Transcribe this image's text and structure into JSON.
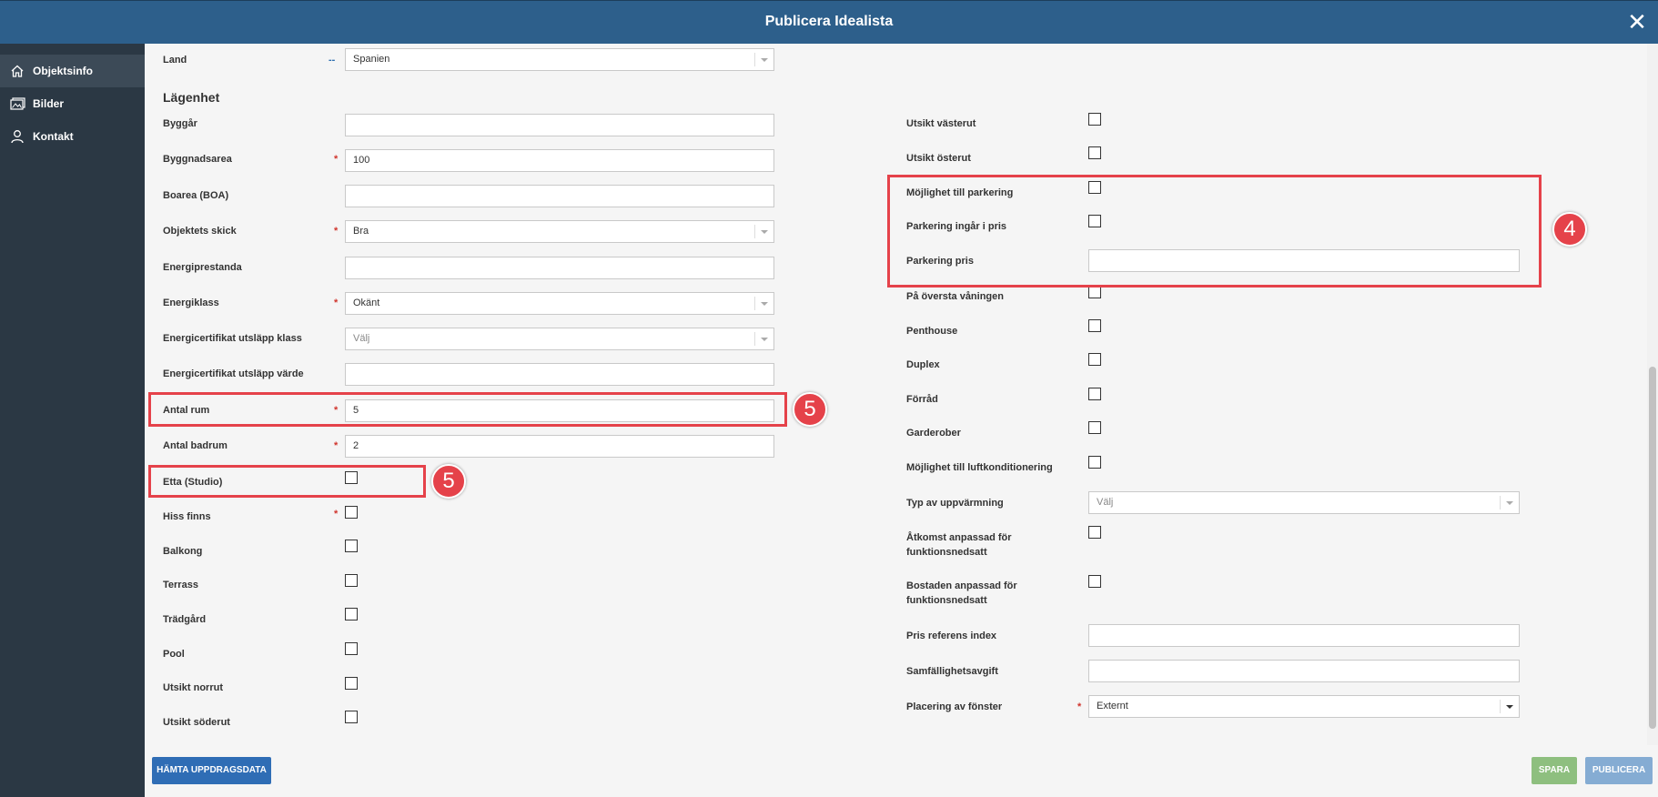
{
  "window": {
    "title": "Publicera Idealista"
  },
  "sidebar": {
    "items": [
      {
        "label": "Objektsinfo"
      },
      {
        "label": "Bilder"
      },
      {
        "label": "Kontakt"
      }
    ]
  },
  "left": {
    "land": {
      "label": "Land",
      "req": "--",
      "value": "Spanien"
    },
    "section_title": "Lägenhet",
    "byggar": {
      "label": "Byggår",
      "value": ""
    },
    "byggnadsarea": {
      "label": "Byggnadsarea",
      "req": "*",
      "value": "100"
    },
    "boarea": {
      "label": "Boarea (BOA)",
      "value": ""
    },
    "skick": {
      "label": "Objektets skick",
      "req": "*",
      "value": "Bra"
    },
    "energiprestanda": {
      "label": "Energiprestanda",
      "value": ""
    },
    "energiklass": {
      "label": "Energiklass",
      "req": "*",
      "value": "Okänt"
    },
    "utslapp_klass": {
      "label": "Energicertifikat utsläpp klass",
      "value": "Välj"
    },
    "utslapp_varde": {
      "label": "Energicertifikat utsläpp värde",
      "value": ""
    },
    "antal_rum": {
      "label": "Antal rum",
      "req": "*",
      "value": "5"
    },
    "antal_badrum": {
      "label": "Antal badrum",
      "req": "*",
      "value": "2"
    },
    "etta": {
      "label": "Etta (Studio)",
      "checked": false
    },
    "hiss": {
      "label": "Hiss finns",
      "req": "*",
      "checked": false
    },
    "balkong": {
      "label": "Balkong",
      "checked": false
    },
    "terrass": {
      "label": "Terrass",
      "checked": false
    },
    "tradgard": {
      "label": "Trädgård",
      "checked": false
    },
    "pool": {
      "label": "Pool",
      "checked": false
    },
    "utsikt_norrut": {
      "label": "Utsikt norrut",
      "checked": false
    },
    "utsikt_soderut": {
      "label": "Utsikt söderut",
      "checked": false
    }
  },
  "right": {
    "utsikt_vasterut": {
      "label": "Utsikt västerut",
      "checked": false
    },
    "utsikt_osterut": {
      "label": "Utsikt österut",
      "checked": false
    },
    "mojlighet_parkering": {
      "label": "Möjlighet till parkering",
      "checked": false
    },
    "parkering_ingar": {
      "label": "Parkering ingår i pris",
      "checked": false
    },
    "parkering_pris": {
      "label": "Parkering pris",
      "value": ""
    },
    "oversta_vaningen": {
      "label": "På översta våningen",
      "checked": false
    },
    "penthouse": {
      "label": "Penthouse",
      "checked": false
    },
    "duplex": {
      "label": "Duplex",
      "checked": false
    },
    "forrad": {
      "label": "Förråd",
      "checked": false
    },
    "garderober": {
      "label": "Garderober",
      "checked": false
    },
    "luftkonditionering": {
      "label": "Möjlighet till luftkonditionering",
      "checked": false
    },
    "uppvarmning": {
      "label": "Typ av uppvärmning",
      "value": "Välj"
    },
    "atkomst": {
      "label": "Åtkomst anpassad för funktionsnedsatt",
      "checked": false
    },
    "bostaden": {
      "label": "Bostaden anpassad för funktionsnedsatt",
      "checked": false
    },
    "pris_referens": {
      "label": "Pris referens index",
      "value": ""
    },
    "samfallighet": {
      "label": "Samfällighetsavgift",
      "value": ""
    },
    "placering": {
      "label": "Placering av fönster",
      "req": "*",
      "value": "Externt"
    }
  },
  "annotations": {
    "badge_4": "4",
    "badge_5a": "5",
    "badge_5b": "5"
  },
  "footer": {
    "fetch_label": "HÄMTA UPPDRAGSDATA",
    "save_label": "SPARA",
    "publish_label": "PUBLICERA"
  },
  "colors": {
    "header": "#2d5f8b",
    "sidebar": "#2b3844",
    "required": "#d0342c",
    "highlight": "#e5424a",
    "fetch_button": "#2f6db5",
    "save_button": "#8ebf7f",
    "publish_button": "#85acd3"
  }
}
